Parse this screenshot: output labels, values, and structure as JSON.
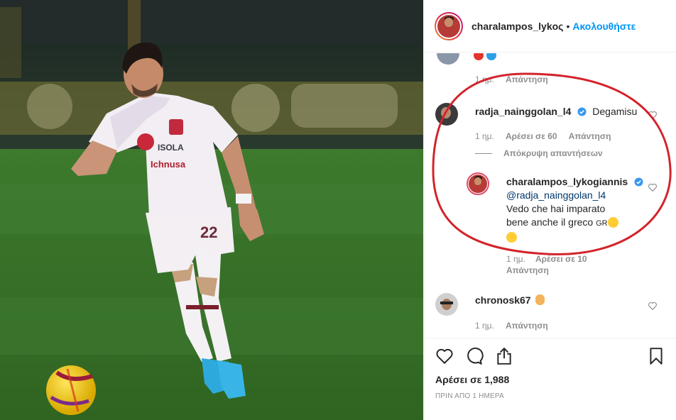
{
  "header": {
    "username": "charalampos_lykoς",
    "separator": "•",
    "follow_label": "Ακολουθήστε"
  },
  "comments": [
    {
      "emojis": "🔴🔵",
      "time": "1 ημ.",
      "reply_label": "Απάντηση"
    },
    {
      "username": "radja_nainggolan_l4",
      "verified": true,
      "text": "Degamisu",
      "time": "1 ημ.",
      "likes": "Αρέσει σε 60",
      "reply_label": "Απάντηση",
      "hide_replies": "Απόκρυψη απαντήσεων",
      "replies": [
        {
          "username": "charalampos_lykogiannis",
          "verified": true,
          "mention": "@radja_nainggolan_l4",
          "text_line1": "Vedo che hai imparato",
          "text_line2": "bene anche il greco",
          "flag": "GR",
          "emoji1": "😂",
          "emoji2": "😉",
          "time": "1 ημ.",
          "likes": "Αρέσει σε 10",
          "reply_label": "Απάντηση"
        }
      ]
    },
    {
      "username": "chronosk67",
      "emoji": "👌",
      "time": "1 ημ.",
      "reply_label": "Απάντηση"
    }
  ],
  "actions": {
    "likes": "Αρέσει σε 1,988",
    "time_ago": "ΠΡΙΝ ΑΠΟ 1 ΗΜΕΡΑ"
  },
  "photo": {
    "shirt_text": "ISOLA",
    "sponsor_text": "Ichnusa",
    "number": "22"
  },
  "colors": {
    "accent_blue": "#0095f6",
    "verified_blue": "#3897f0",
    "annotation_red": "#d3242b",
    "pitch_green": "#3f7a2c"
  }
}
